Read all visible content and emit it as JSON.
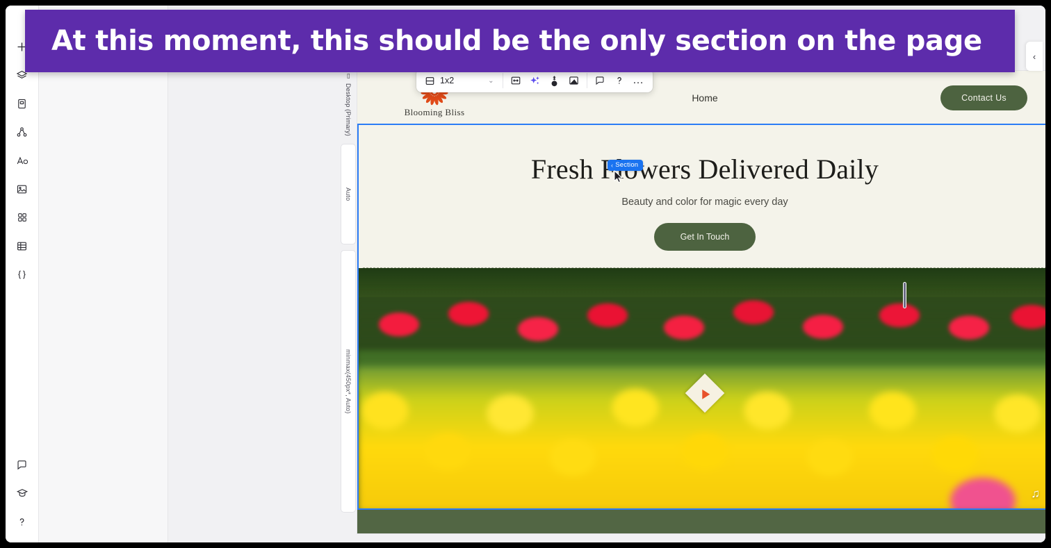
{
  "annotation": {
    "text": "At this moment, this should be the only section on the page",
    "bg": "#5d2cab",
    "fg": "#ffffff"
  },
  "rail": {
    "top_items": [
      {
        "name": "add-icon",
        "label": "Add"
      },
      {
        "name": "layers-icon",
        "label": "Layers"
      },
      {
        "name": "page-icon",
        "label": "Page"
      },
      {
        "name": "sitemap-icon",
        "label": "Site Structure"
      },
      {
        "name": "text-icon",
        "label": "Text"
      },
      {
        "name": "image-icon",
        "label": "Media"
      },
      {
        "name": "apps-icon",
        "label": "Apps"
      },
      {
        "name": "table-icon",
        "label": "CMS"
      },
      {
        "name": "code-icon",
        "label": "Dev Mode"
      }
    ],
    "bottom_items": [
      {
        "name": "comment-icon",
        "label": "Comments"
      },
      {
        "name": "graduation-icon",
        "label": "Learn"
      },
      {
        "name": "help-icon",
        "label": "Help"
      }
    ]
  },
  "canvas": {
    "viewport_label": "Desktop (Primary)",
    "track_auto": "Auto",
    "track_minmax": "minmax(450px*, Auto)",
    "selection_color": "#2b7cf6"
  },
  "toolbar": {
    "layout_label": "1x2",
    "layout_chevron": "⌄",
    "buttons": [
      {
        "name": "stretch-width-icon",
        "label": "Stretch"
      },
      {
        "name": "ai-sparkle-icon",
        "label": "AI Assist"
      },
      {
        "name": "design-droplet-icon",
        "label": "Design"
      },
      {
        "name": "background-icon",
        "label": "Background"
      }
    ],
    "right_buttons": [
      {
        "name": "comment-icon",
        "label": "Comment"
      },
      {
        "name": "help-icon",
        "label": "Help"
      },
      {
        "name": "more-icon",
        "label": "…"
      }
    ]
  },
  "section_badge": {
    "chevron": "‹",
    "label": "Section"
  },
  "right_panel": {
    "toggle_chevron": "‹"
  },
  "site": {
    "brand": {
      "name": "Blooming Bliss",
      "logo_icon": "sunburst-flower-icon",
      "logo_color": "#e04a18"
    },
    "nav": {
      "home": "Home"
    },
    "contact_button": "Contact Us",
    "hero": {
      "title": "Fresh Flowers Delivered Daily",
      "subtitle": "Beauty and color for magic every day",
      "cta": "Get In Touch"
    },
    "video": {
      "play_icon": "play-triangle-icon",
      "audio_icon": "♫"
    },
    "colors": {
      "page_bg": "#f4f3ea",
      "accent_green": "#4d6340",
      "footer_green": "#526644"
    }
  }
}
